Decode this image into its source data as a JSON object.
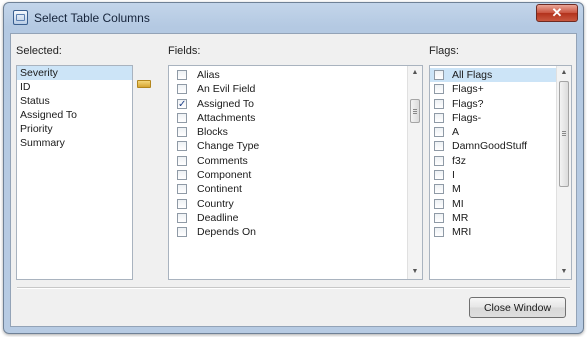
{
  "window": {
    "title": "Select Table Columns",
    "close_glyph": "✕"
  },
  "selected_panel": {
    "label": "Selected:",
    "items": [
      "Severity",
      "ID",
      "Status",
      "Assigned To",
      "Priority",
      "Summary"
    ]
  },
  "fields_panel": {
    "label": "Fields:",
    "items": [
      {
        "label": "Alias",
        "checked": false
      },
      {
        "label": "An Evil Field",
        "checked": false
      },
      {
        "label": "Assigned To",
        "checked": true
      },
      {
        "label": "Attachments",
        "checked": false
      },
      {
        "label": "Blocks",
        "checked": false
      },
      {
        "label": "Change Type",
        "checked": false
      },
      {
        "label": "Comments",
        "checked": false
      },
      {
        "label": "Component",
        "checked": false
      },
      {
        "label": "Continent",
        "checked": false
      },
      {
        "label": "Country",
        "checked": false
      },
      {
        "label": "Deadline",
        "checked": false
      },
      {
        "label": "Depends On",
        "checked": false
      }
    ]
  },
  "flags_panel": {
    "label": "Flags:",
    "items": [
      {
        "label": "All Flags",
        "checked": false
      },
      {
        "label": "Flags+",
        "checked": false
      },
      {
        "label": "Flags?",
        "checked": false
      },
      {
        "label": "Flags-",
        "checked": false
      },
      {
        "label": "A",
        "checked": false
      },
      {
        "label": "DamnGoodStuff",
        "checked": false
      },
      {
        "label": "f3z",
        "checked": false
      },
      {
        "label": "I",
        "checked": false
      },
      {
        "label": "M",
        "checked": false
      },
      {
        "label": "MI",
        "checked": false
      },
      {
        "label": "MR",
        "checked": false
      },
      {
        "label": "MRI",
        "checked": false
      }
    ]
  },
  "footer": {
    "close_button_label": "Close Window"
  },
  "icons": {
    "move": "arrow-right-icon",
    "check": "checkmark-icon",
    "scroll_up": "arrow-up-icon",
    "scroll_down": "arrow-down-icon"
  },
  "colors": {
    "title_bar": "#b4c9e2",
    "close_button": "#c9533e",
    "selection": "#cce4f7"
  }
}
